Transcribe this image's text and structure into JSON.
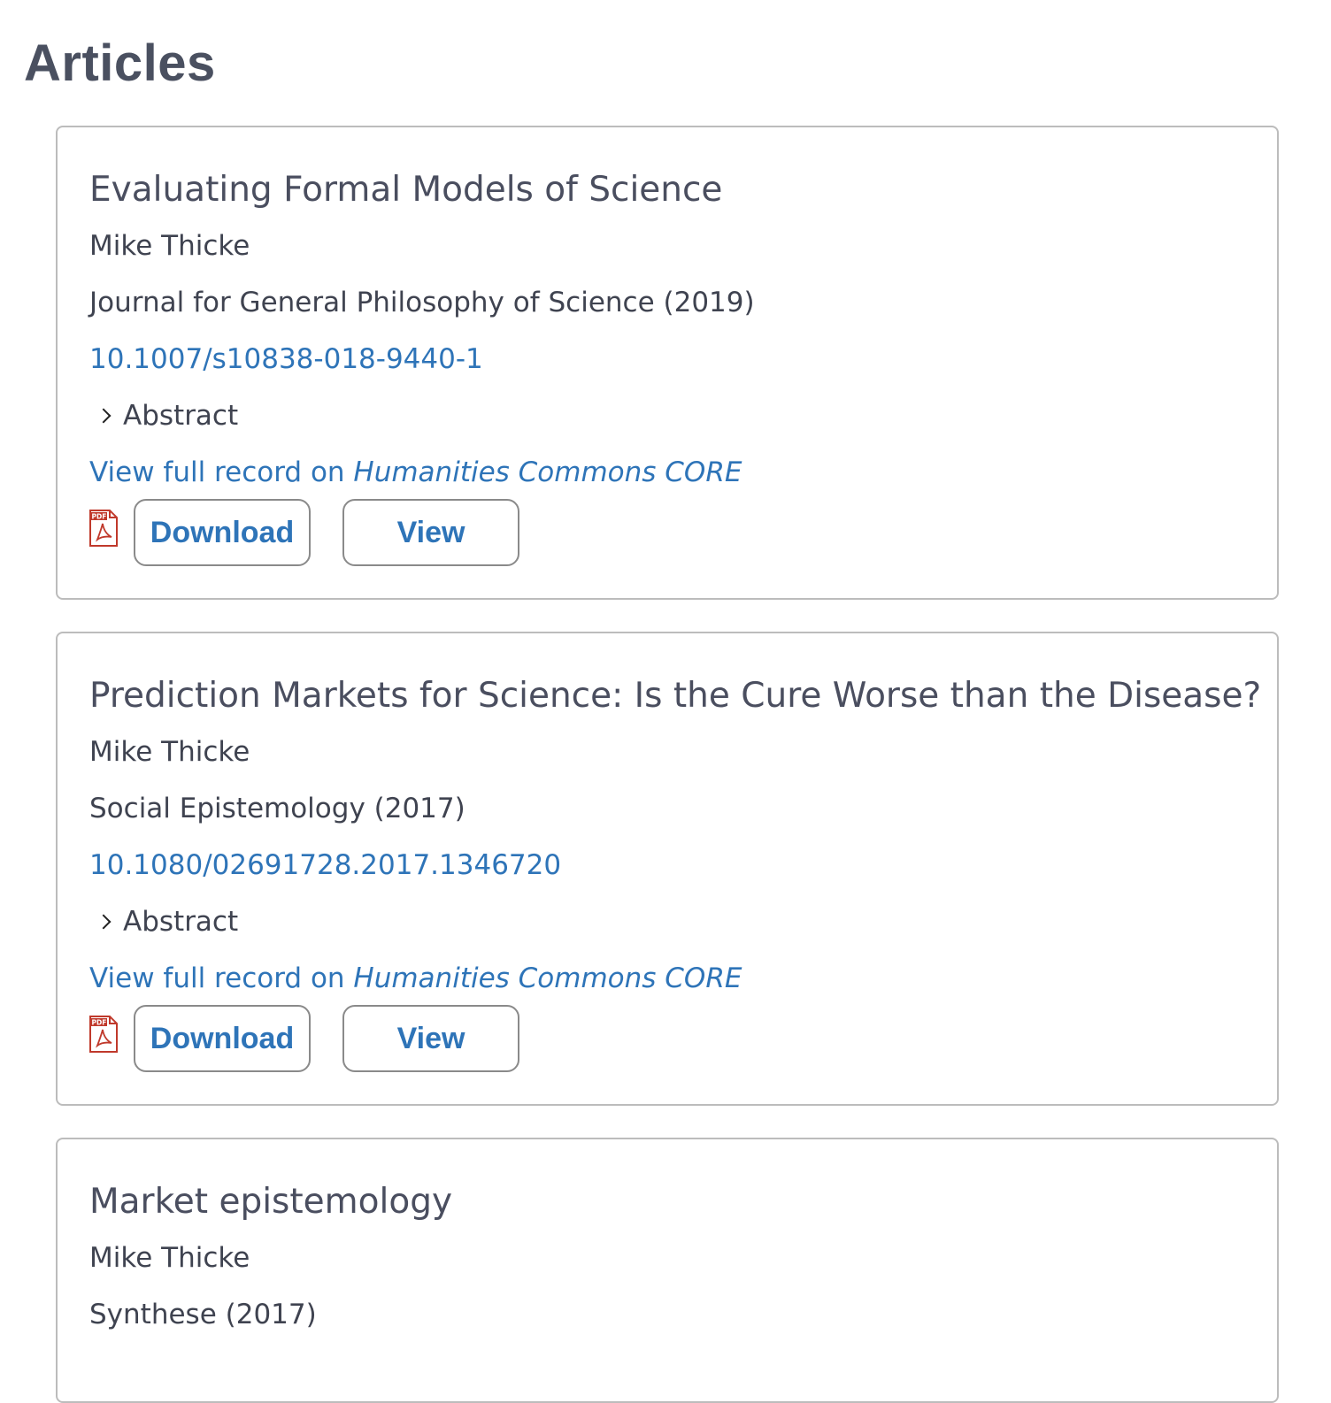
{
  "page": {
    "title": "Articles"
  },
  "articles": [
    {
      "title": "Evaluating Formal Models of Science",
      "author": "Mike Thicke",
      "journal": "Journal for General Philosophy of Science (2019)",
      "doi": "10.1007/s10838-018-9440-1",
      "abstract_label": "Abstract",
      "record_prefix": "View full record on ",
      "record_source": "Humanities Commons CORE",
      "download_label": "Download",
      "view_label": "View",
      "pdf_icon_text": "PDF"
    },
    {
      "title": "Prediction Markets for Science: Is the Cure Worse than the Disease?",
      "author": "Mike Thicke",
      "journal": "Social Epistemology (2017)",
      "doi": "10.1080/02691728.2017.1346720",
      "abstract_label": "Abstract",
      "record_prefix": "View full record on ",
      "record_source": "Humanities Commons CORE",
      "download_label": "Download",
      "view_label": "View",
      "pdf_icon_text": "PDF"
    },
    {
      "title": "Market epistemology",
      "author": "Mike Thicke",
      "journal": "Synthese (2017)"
    }
  ],
  "colors": {
    "link": "#2e74b8",
    "text": "#4a4e5f",
    "pdf_red": "#c0392b"
  }
}
